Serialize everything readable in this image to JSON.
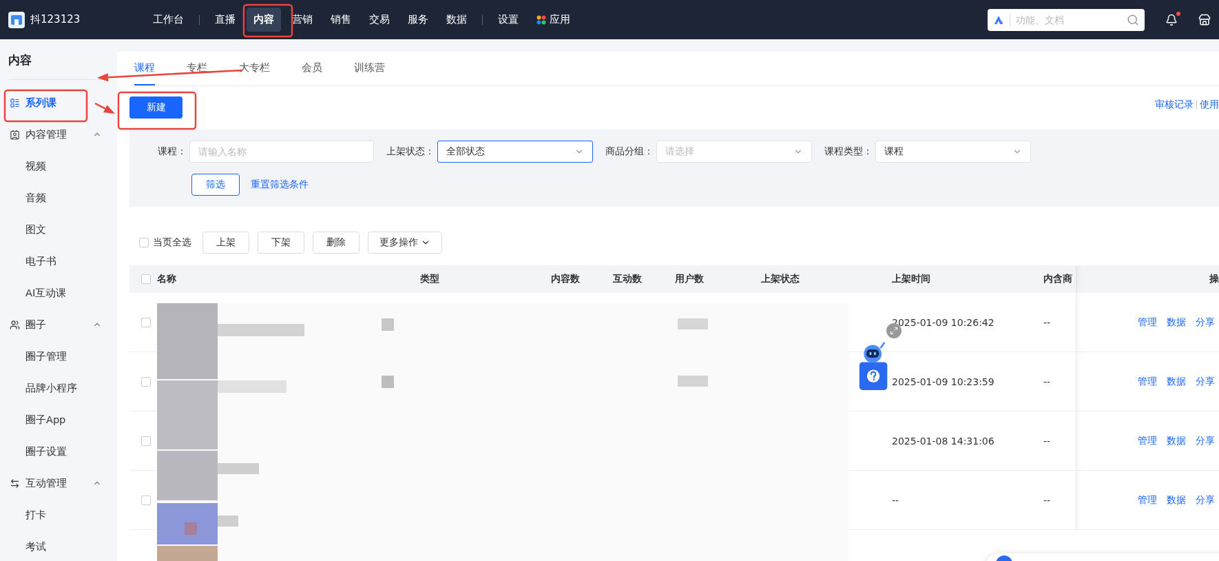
{
  "topbar": {
    "brand": "抖123123",
    "nav": [
      {
        "label": "工作台",
        "selected": false,
        "divider_after": true
      },
      {
        "label": "直播",
        "selected": false,
        "divider_after": false
      },
      {
        "label": "内容",
        "selected": true,
        "divider_after": false
      },
      {
        "label": "营销",
        "selected": false,
        "divider_after": false
      },
      {
        "label": "销售",
        "selected": false,
        "divider_after": false
      },
      {
        "label": "交易",
        "selected": false,
        "divider_after": false
      },
      {
        "label": "服务",
        "selected": false,
        "divider_after": false
      },
      {
        "label": "数据",
        "selected": false,
        "divider_after": true
      },
      {
        "label": "设置",
        "selected": false,
        "divider_after": false
      },
      {
        "label": "应用",
        "selected": false,
        "divider_after": false,
        "kind": "apps"
      }
    ],
    "search": {
      "placeholder": "功能、文档"
    },
    "notifications": {
      "unread": true
    }
  },
  "sidebar": {
    "title": "内容",
    "items": [
      {
        "label": "系列课",
        "selected": true
      },
      {
        "label": "内容管理",
        "selected": false,
        "expanded": true,
        "children": [
          {
            "label": "视频",
            "selected": false
          },
          {
            "label": "音频",
            "selected": false
          },
          {
            "label": "图文",
            "selected": false
          },
          {
            "label": "电子书",
            "selected": false
          },
          {
            "label": "AI互动课",
            "selected": false
          }
        ]
      },
      {
        "label": "圈子",
        "selected": false,
        "expanded": true,
        "children": [
          {
            "label": "圈子管理",
            "selected": false
          },
          {
            "label": "品牌小程序",
            "selected": false
          },
          {
            "label": "圈子App",
            "selected": false
          },
          {
            "label": "圈子设置",
            "selected": false
          }
        ]
      },
      {
        "label": "互动管理",
        "selected": false,
        "expanded": true,
        "children": [
          {
            "label": "打卡",
            "selected": false
          },
          {
            "label": "考试",
            "selected": false
          }
        ]
      }
    ]
  },
  "tabs": [
    {
      "label": "课程",
      "selected": true
    },
    {
      "label": "专栏",
      "selected": false
    },
    {
      "label": "大专栏",
      "selected": false
    },
    {
      "label": "会员",
      "selected": false
    },
    {
      "label": "训练营",
      "selected": false
    }
  ],
  "new_button": "新建",
  "header_links": [
    "审核记录",
    "使用"
  ],
  "filters": [
    {
      "label": "课程：",
      "kind": "input",
      "placeholder": "请输入名称",
      "focused": false
    },
    {
      "label": "上架状态：",
      "kind": "select",
      "value": "全部状态",
      "focused": true
    },
    {
      "label": "商品分组：",
      "kind": "select",
      "placeholder": "请选择",
      "focused": false
    },
    {
      "label": "课程类型：",
      "kind": "select",
      "value": "课程",
      "focused": false
    }
  ],
  "filter_button": "筛选",
  "reset_link": "重置筛选条件",
  "bulk": {
    "select_all": {
      "label": "当页全选",
      "checked": false
    },
    "buttons": [
      "上架",
      "下架",
      "删除"
    ],
    "more": "更多操作"
  },
  "table": {
    "columns": [
      "名称",
      "类型",
      "内容数",
      "互动数",
      "用户数",
      "上架状态",
      "上架时间",
      "内含商",
      "操"
    ],
    "header_checked": false,
    "rows": [
      {
        "checked": false,
        "time": "2025-01-09 10:26:42",
        "column_8": "--",
        "actions": [
          "管理",
          "数据",
          "分享"
        ]
      },
      {
        "checked": false,
        "time": "2025-01-09 10:23:59",
        "column_8": "--",
        "actions": [
          "管理",
          "数据",
          "分享"
        ]
      },
      {
        "checked": false,
        "time": "2025-01-08 14:31:06",
        "column_8": "--",
        "actions": [
          "管理",
          "数据",
          "分享"
        ]
      },
      {
        "checked": false,
        "time": "--",
        "column_8": "--",
        "actions": [
          "管理",
          "数据",
          "分享"
        ]
      }
    ]
  }
}
